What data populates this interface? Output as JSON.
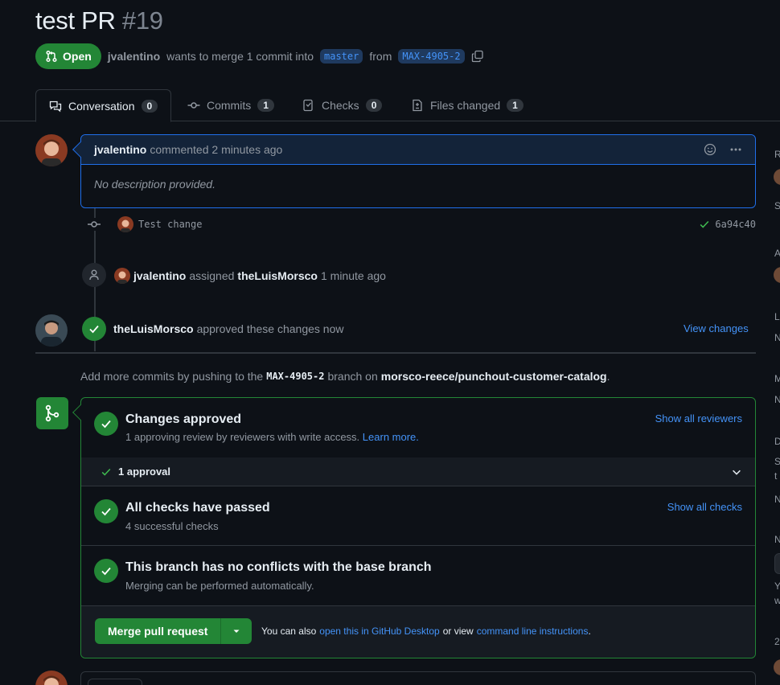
{
  "pr": {
    "title": "test PR",
    "number": "#19",
    "state": "Open",
    "author": "jvalentino",
    "merge_text": "wants to merge 1 commit into",
    "base_branch": "master",
    "from_text": "from",
    "head_branch": "MAX-4905-2"
  },
  "tabs": [
    {
      "label": "Conversation",
      "count": "0"
    },
    {
      "label": "Commits",
      "count": "1"
    },
    {
      "label": "Checks",
      "count": "0"
    },
    {
      "label": "Files changed",
      "count": "1"
    }
  ],
  "comment": {
    "author": "jvalentino",
    "action": "commented 2 minutes ago",
    "body": "No description provided."
  },
  "commit": {
    "message": "Test change",
    "sha": "6a94c40"
  },
  "assign_event": {
    "actor": "jvalentino",
    "verb": "assigned",
    "target": "theLuisMorsco",
    "time": "1 minute ago"
  },
  "approve_event": {
    "actor": "theLuisMorsco",
    "text": "approved these changes now",
    "link": "View changes"
  },
  "push_hint": {
    "prefix": "Add more commits by pushing to the",
    "branch": "MAX-4905-2",
    "middle": "branch on",
    "repo": "morsco-reece/punchout-customer-catalog",
    "suffix": "."
  },
  "mergebox": {
    "approved_title": "Changes approved",
    "approved_sub": "1 approving review by reviewers with write access.",
    "learn_more": "Learn more.",
    "show_reviewers": "Show all reviewers",
    "approval_count": "1 approval",
    "checks_title": "All checks have passed",
    "checks_sub": "4 successful checks",
    "show_checks": "Show all checks",
    "conflicts_title": "This branch has no conflicts with the base branch",
    "conflicts_sub": "Merging can be performed automatically.",
    "merge_button": "Merge pull request",
    "also_text": "You can also",
    "desktop_link": "open this in GitHub Desktop",
    "or_view": "or view",
    "cli_link": "command line instructions",
    "end": "."
  },
  "sidebar_letters": [
    "R",
    "S",
    "A",
    "L",
    "N",
    "M",
    "N",
    "D",
    "S",
    "t",
    "N",
    "N",
    "Y",
    "w",
    "2"
  ],
  "colors": {
    "accent": "#4493f8",
    "success": "#238636",
    "bg": "#0d1117",
    "border": "#30363d"
  }
}
